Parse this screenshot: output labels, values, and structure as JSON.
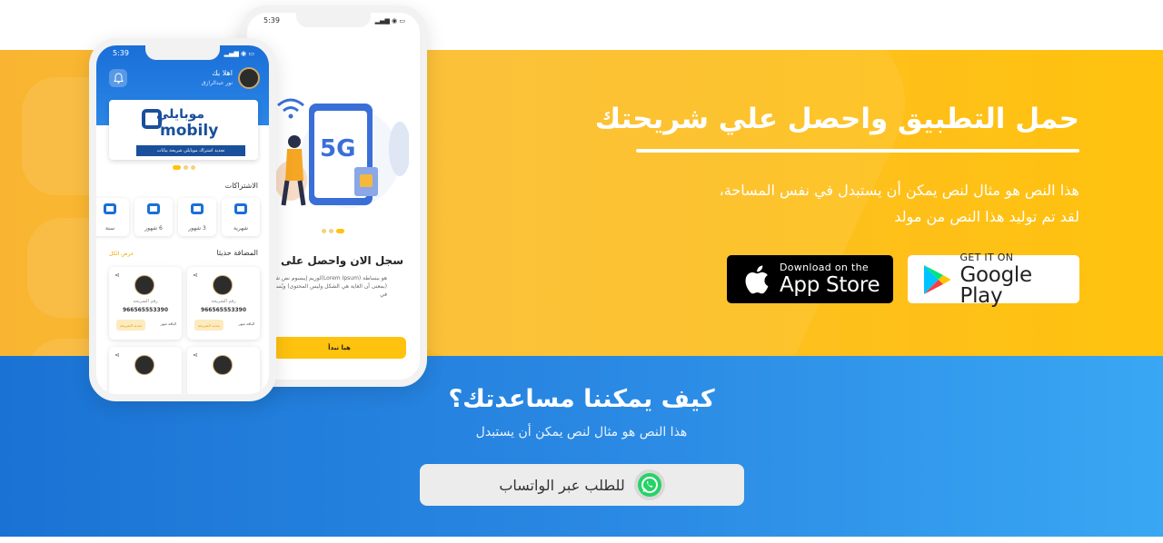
{
  "colors": {
    "yellow": "#ffc20e",
    "blue": "#1a73d4",
    "whatsapp": "#25d366",
    "mobily_blue": "#1a4f9c"
  },
  "download": {
    "title": "حمل التطبيق واحصل علي شريحتك",
    "description": "هذا النص هو مثال لنص يمكن أن يستبدل في نفس المساحة، لقد تم توليد هذا النص من مولد",
    "app_store": {
      "small": "Download on the",
      "big": "App Store"
    },
    "google_play": {
      "small": "GET IT ON",
      "big": "Google Play"
    }
  },
  "help": {
    "title": "كيف يمكننا مساعدتك؟",
    "subtitle": "هذا النص هو مثال لنص يمكن أن يستبدل",
    "whatsapp_label": "للطلب عبر الواتساب"
  },
  "onboarding_phone": {
    "time": "5:39",
    "title": "سجل الان واحصل على شريحتك",
    "body": "هو ببساطة (Lorem Ipsum)لوريم إيبسوم نص شكلي (بمعنى أن الغاية هي الشكل وليس المحتوى) ويُستخدم في",
    "button": "هيا نبدأ",
    "art_text": "5G"
  },
  "home_phone": {
    "time": "5:39",
    "greeting": "اهلا بك",
    "user_name": "نور عبدالرازق",
    "banner_ar": "موبايلي",
    "banner_en": "mobily",
    "banner_strip": "تجديد اشتراك موبايلي شريحة بيانات",
    "subscriptions_title": "الاشتراكات",
    "plans": [
      "شهرية",
      "3 شهور",
      "6 شهور",
      "سنة"
    ],
    "recent_title": "المضافة حديثا",
    "view_all": "عرض الكل",
    "sims": [
      {
        "label": "رقم الشريحة",
        "number": "966565553390",
        "pill": "تجديد الشريحة",
        "info": "الباقة شهر"
      },
      {
        "label": "رقم الشريحة",
        "number": "966565553390",
        "pill": "تجديد الشريحة",
        "info": "الباقة شهر"
      }
    ]
  }
}
